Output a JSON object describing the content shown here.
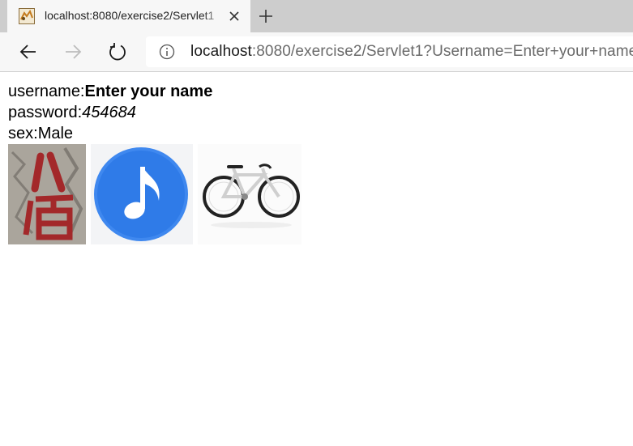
{
  "tab": {
    "title": "localhost:8080/exercise2/Servlet1"
  },
  "address_bar": {
    "url_host": "localhost",
    "url_rest": ":8080/exercise2/Servlet1?Username=Enter+your+name"
  },
  "content": {
    "username_label": "username:",
    "username_value": "Enter your name",
    "password_label": "password:",
    "password_value": "454684",
    "sex_label": "sex:",
    "sex_value": "Male"
  },
  "images": [
    {
      "icon": "chinese-characters-poster-image"
    },
    {
      "icon": "music-note-icon",
      "color": "#2f7be8"
    },
    {
      "icon": "bicycle-image"
    }
  ],
  "colors": {
    "tabstrip": "#cdcdcd",
    "toolbar": "#f7f7f7",
    "music_circle": "#2f7be8",
    "poster_red": "#a3282a"
  }
}
